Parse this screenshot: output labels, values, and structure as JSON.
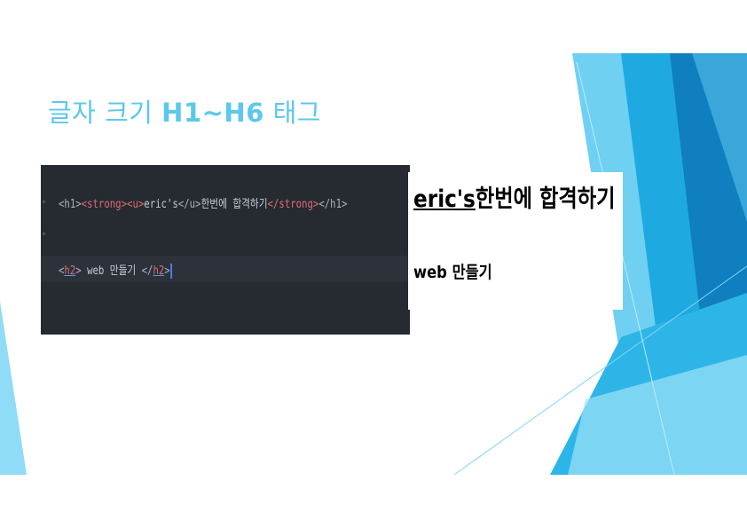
{
  "slide": {
    "title_prefix": "글자 크기 ",
    "title_strong": "H1~H6",
    "title_suffix": " 태그"
  },
  "code_editor": {
    "line1": {
      "h1_open": "<h1>",
      "strong_open": "<strong>",
      "u_open": "<u>",
      "u_text": "eric's",
      "u_close": "</u>",
      "text": "한번에 합격하기",
      "strong_close": "</strong>",
      "h1_close": "</h1>"
    },
    "line2": {
      "lt": "<",
      "tag_name": "h2",
      "gt": ">",
      "text": " web 만들기 ",
      "close_lt": "</",
      "close_tag_name": "h2",
      "close_gt": ">"
    }
  },
  "preview": {
    "h1_underlined": "eric's",
    "h1_text": "한번에 합격하기",
    "h2_text": "web 만들기"
  },
  "colors": {
    "title": "#5bc8ec",
    "editor_bg": "#262a31",
    "tag": "#e06c75",
    "accent_blue": "#1fa9e1"
  }
}
